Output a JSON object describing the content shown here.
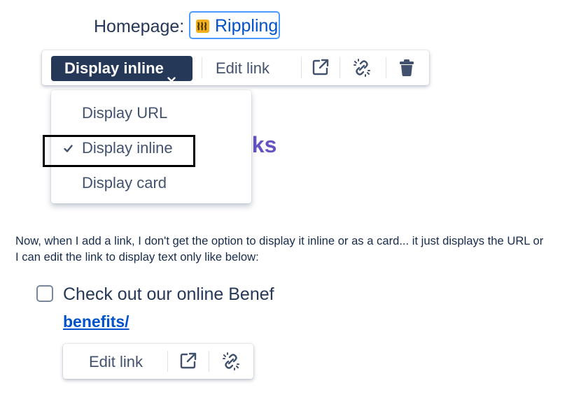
{
  "homepage": {
    "label": "Homepage:",
    "chip_text": "Rippling"
  },
  "toolbar_top": {
    "dropdown_label": "Display inline",
    "edit_link_label": "Edit link",
    "icons": [
      "open-external-icon",
      "unlink-icon",
      "trash-icon"
    ]
  },
  "dropdown_menu": {
    "items": [
      {
        "label": "Display URL",
        "checked": false
      },
      {
        "label": "Display inline",
        "checked": true
      },
      {
        "label": "Display card",
        "checked": false
      }
    ]
  },
  "heading_partial": "sks",
  "paragraph": "Now, when I add a link, I don't get the option to display it inline or as a card... it just displays the URL or I can edit the link to display text only like below:",
  "task": {
    "text": "Check out our online Benef",
    "link_text": "benefits/"
  },
  "toolbar_bottom": {
    "edit_link_label": "Edit link",
    "icons": [
      "open-external-icon",
      "unlink-icon"
    ]
  },
  "colors": {
    "primary_dark": "#253858",
    "link_blue": "#0052cc",
    "heading_purple": "#6554c0",
    "chip_border": "#4c9aff",
    "logo_yellow": "#f2b01e"
  }
}
